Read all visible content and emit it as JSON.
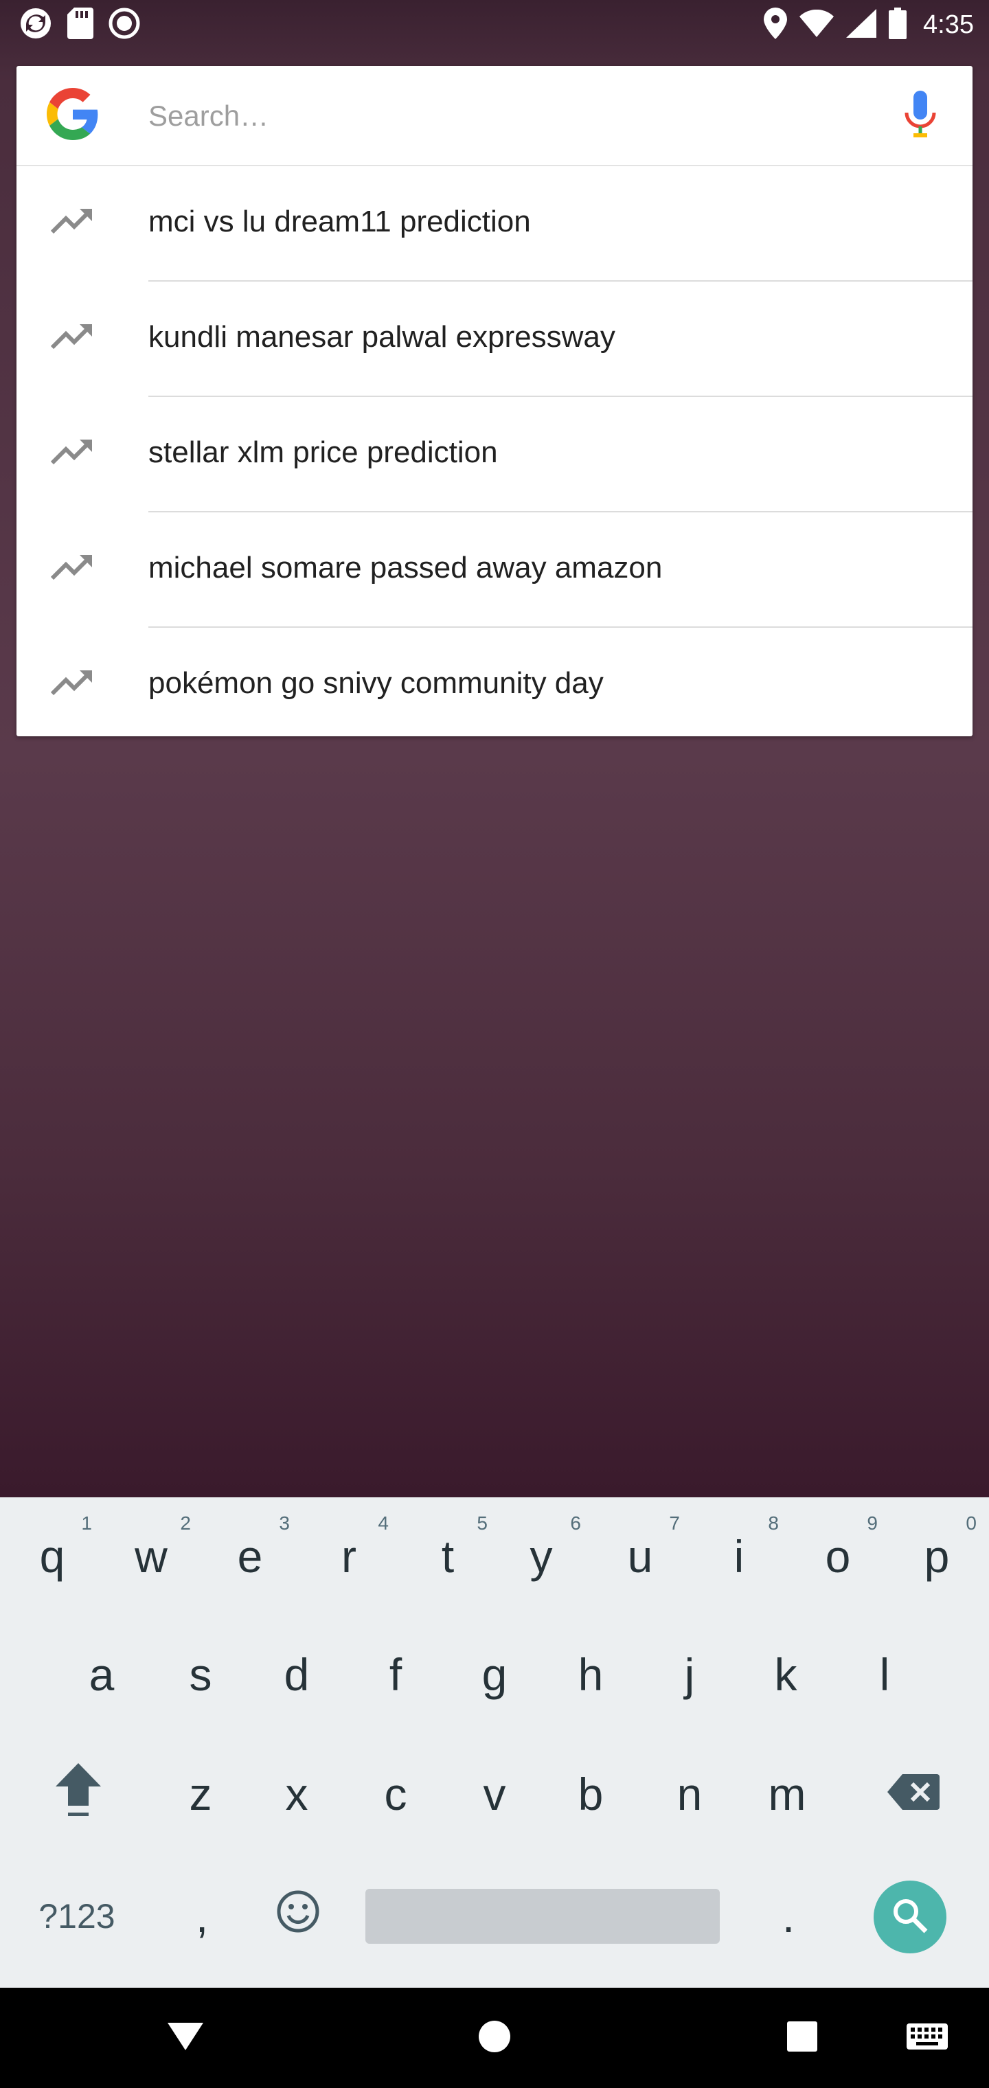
{
  "status_bar": {
    "time": "4:35",
    "left_icons": [
      "sync-icon",
      "sd-card-icon",
      "record-icon"
    ],
    "right_icons": [
      "location-icon",
      "wifi-icon",
      "signal-icon",
      "battery-icon"
    ]
  },
  "search": {
    "placeholder": "Search…",
    "value": ""
  },
  "suggestions": [
    {
      "label": "mci vs lu dream11 prediction",
      "icon": "trending-icon"
    },
    {
      "label": "kundli manesar palwal expressway",
      "icon": "trending-icon"
    },
    {
      "label": "stellar xlm price prediction",
      "icon": "trending-icon"
    },
    {
      "label": "michael somare passed away amazon",
      "icon": "trending-icon"
    },
    {
      "label": "pokémon go snivy community day",
      "icon": "trending-icon"
    }
  ],
  "keyboard": {
    "row1": [
      {
        "k": "q",
        "h": "1"
      },
      {
        "k": "w",
        "h": "2"
      },
      {
        "k": "e",
        "h": "3"
      },
      {
        "k": "r",
        "h": "4"
      },
      {
        "k": "t",
        "h": "5"
      },
      {
        "k": "y",
        "h": "6"
      },
      {
        "k": "u",
        "h": "7"
      },
      {
        "k": "i",
        "h": "8"
      },
      {
        "k": "o",
        "h": "9"
      },
      {
        "k": "p",
        "h": "0"
      }
    ],
    "row2": [
      "a",
      "s",
      "d",
      "f",
      "g",
      "h",
      "j",
      "k",
      "l"
    ],
    "row3": [
      "z",
      "x",
      "c",
      "v",
      "b",
      "n",
      "m"
    ],
    "symbols_label": "?123",
    "comma": ",",
    "period": "."
  },
  "colors": {
    "accent_search_key": "#4db6ac",
    "keyboard_bg": "#eceff1",
    "google_blue": "#4285F4",
    "google_red": "#EA4335",
    "google_yellow": "#FBBC05",
    "google_green": "#34A853"
  }
}
